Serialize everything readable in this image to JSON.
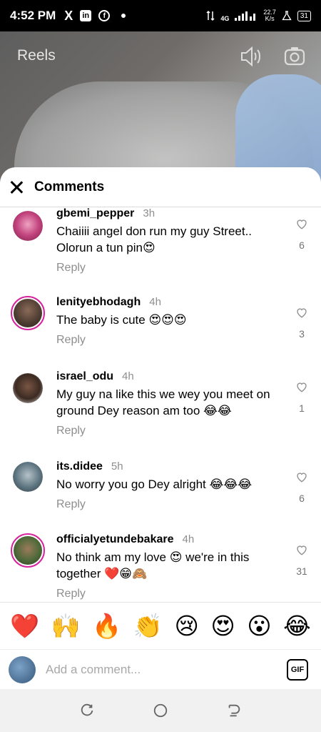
{
  "status_bar": {
    "time": "4:52 PM",
    "x_glyph": "X",
    "linkedin_glyph": "in",
    "facebook_glyph": "f",
    "network_type": "4G",
    "speed_value": "22.7",
    "speed_unit": "K/s",
    "battery": "31"
  },
  "reel": {
    "title": "Reels",
    "icons": [
      "speaker-icon",
      "camera-icon"
    ]
  },
  "sheet": {
    "title": "Comments",
    "reply_label": "Reply",
    "comments": [
      {
        "username": "gbemi_pepper",
        "time": "3h",
        "text": "Chaiiii angel don run my guy Street.. Olorun a tun pin😍",
        "likes": "6"
      },
      {
        "username": "lenityebhodagh",
        "time": "4h",
        "text": "The baby is cute 😍😍😍",
        "likes": "3"
      },
      {
        "username": "israel_odu",
        "time": "4h",
        "text": "My guy na like this we wey you meet on ground Dey reason am too 😂😂",
        "likes": "1"
      },
      {
        "username": "its.didee",
        "time": "5h",
        "text": "No worry you go Dey alright 😂😂😂",
        "likes": "6"
      },
      {
        "username": "officialyetundebakare",
        "time": "4h",
        "text": "No think am my love 😍 we're in this together ❤️😁🙈",
        "likes": "31"
      }
    ]
  },
  "emoji_bar": [
    "❤️",
    "🙌",
    "🔥",
    "👏",
    "😢",
    "😍",
    "😮",
    "😂"
  ],
  "comment_input": {
    "placeholder": "Add a comment...",
    "gif_label": "GIF"
  },
  "colors": {
    "ring": "#d6249f",
    "muted_text": "#8e8e8e"
  }
}
